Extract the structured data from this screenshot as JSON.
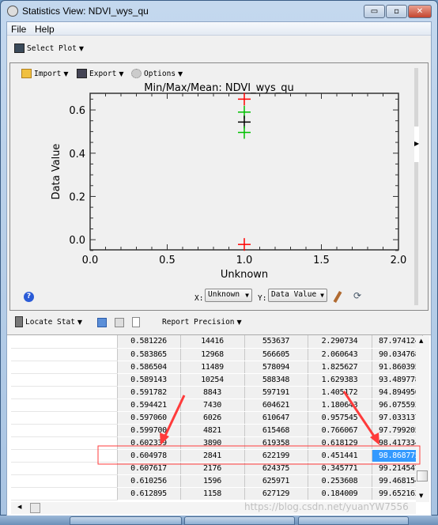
{
  "window": {
    "title": "Statistics View: NDVI_wys_qu",
    "minimize": "▭",
    "maximize": "▫",
    "close": "✕"
  },
  "menu": [
    "File",
    "Help"
  ],
  "toolbar": {
    "select_plot": "Select Plot"
  },
  "plot_toolbar": {
    "import": "Import",
    "export": "Export",
    "options": "Options"
  },
  "chart_data": {
    "type": "scatter",
    "title": "Min/Max/Mean: NDVI_wys_qu",
    "xlabel": "Unknown",
    "ylabel": "Data Value",
    "xlim": [
      0,
      2
    ],
    "ylim": [
      -0.047,
      0.677
    ],
    "xticks": [
      "0.0",
      "0.5",
      "1.0",
      "1.5",
      "2.0"
    ],
    "yticks": [
      "0.0",
      "0.2",
      "0.4",
      "0.6"
    ],
    "points": [
      {
        "x": 1.0,
        "y": 0.65,
        "color": "#ff0000"
      },
      {
        "x": 1.0,
        "y": 0.59,
        "color": "#00c000"
      },
      {
        "x": 1.0,
        "y": 0.544,
        "color": "#000000"
      },
      {
        "x": 1.0,
        "y": 0.496,
        "color": "#00c000"
      },
      {
        "x": 1.0,
        "y": -0.022,
        "color": "#ff0000"
      }
    ],
    "grid": false
  },
  "axis_controls": {
    "x_label": "X:",
    "x_value": "Unknown",
    "y_label": "Y:",
    "y_value": "Data Value"
  },
  "stats_toolbar": {
    "locate_stat": "Locate Stat",
    "report_precision": "Report Precision"
  },
  "table": {
    "rows": [
      [
        "",
        "0.581226",
        "14416",
        "553637",
        "2.290734",
        "87.974124"
      ],
      [
        "",
        "0.583865",
        "12968",
        "566605",
        "2.060643",
        "90.034768"
      ],
      [
        "",
        "0.586504",
        "11489",
        "578094",
        "1.825627",
        "91.860395"
      ],
      [
        "",
        "0.589143",
        "10254",
        "588348",
        "1.629383",
        "93.489778"
      ],
      [
        "",
        "0.591782",
        "8843",
        "597191",
        "1.405172",
        "94.894950"
      ],
      [
        "",
        "0.594421",
        "7430",
        "604621",
        "1.180643",
        "96.075593"
      ],
      [
        "",
        "0.597060",
        "6026",
        "610647",
        "0.957545",
        "97.033137"
      ],
      [
        "",
        "0.599700",
        "4821",
        "615468",
        "0.766067",
        "97.799205"
      ],
      [
        "",
        "0.602339",
        "3890",
        "619358",
        "0.618129",
        "98.417334"
      ],
      [
        "",
        "0.604978",
        "2841",
        "622199",
        "0.451441",
        "98.868775"
      ],
      [
        "",
        "0.607617",
        "2176",
        "624375",
        "0.345771",
        "99.214547"
      ],
      [
        "",
        "0.610256",
        "1596",
        "625971",
        "0.253608",
        "99.468154"
      ],
      [
        "",
        "0.612895",
        "1158",
        "627129",
        "0.184009",
        "99.652163"
      ]
    ],
    "selected_row": 9,
    "annotation_color": "#ff3b3b"
  },
  "watermark": "https://blog.csdn.net/yuanYW7556"
}
